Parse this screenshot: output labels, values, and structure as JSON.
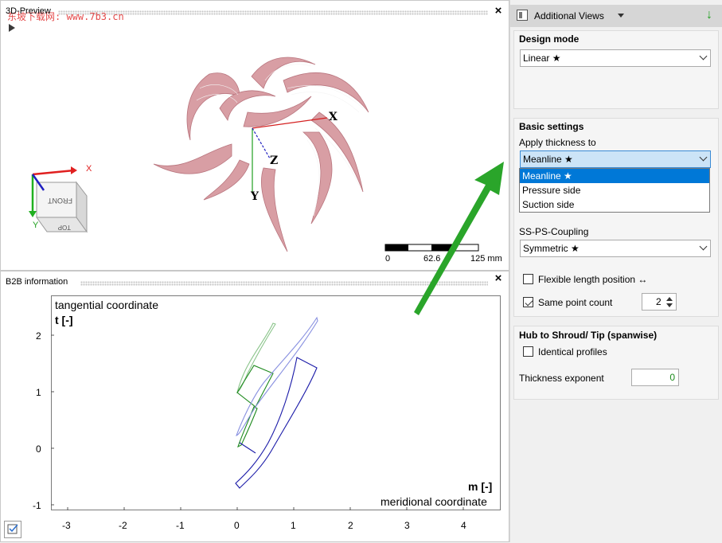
{
  "preview": {
    "title": "3D-Preview",
    "watermark": "东坡下载网: www.7b3.cn",
    "axis_x": "X",
    "axis_y": "Y",
    "axis_z": "Z",
    "cube_front": "FRONT",
    "cube_top": "TOP",
    "scale": {
      "t0": "0",
      "t1": "62.6",
      "t2": "125 mm"
    }
  },
  "b2b": {
    "title": "B2B information",
    "y_title": "tangential coordinate",
    "y_unit": "t [-]",
    "x_unit": "m [-]",
    "x_title": "meridional coordinate",
    "x_ticks": [
      "-3",
      "-2",
      "-1",
      "0",
      "1",
      "2",
      "3",
      "4"
    ],
    "y_ticks": [
      "2",
      "1",
      "0",
      "-1"
    ]
  },
  "side": {
    "header": "Additional Views",
    "design_mode_title": "Design mode",
    "design_mode_value": "Linear ★",
    "basic_title": "Basic settings",
    "apply_thickness_label": "Apply thickness to",
    "apply_thickness_value": "Meanline ★",
    "thickness_options": [
      "Meanline ★",
      "Pressure side",
      "Suction side"
    ],
    "coupling_label": "SS-PS-Coupling",
    "coupling_value": "Symmetric ★",
    "flexible_label": "Flexible length position ↔",
    "same_count_label": "Same point count",
    "same_count_value": "2",
    "hub_title": "Hub to Shroud/ Tip (spanwise)",
    "identical_label": "Identical profiles",
    "exponent_label": "Thickness exponent",
    "exponent_value": "0"
  },
  "colors": {
    "arrow": "#2aa52a",
    "blade": "#d4969c",
    "blue": "#1a1aa8",
    "green": "#1e8a1e"
  }
}
